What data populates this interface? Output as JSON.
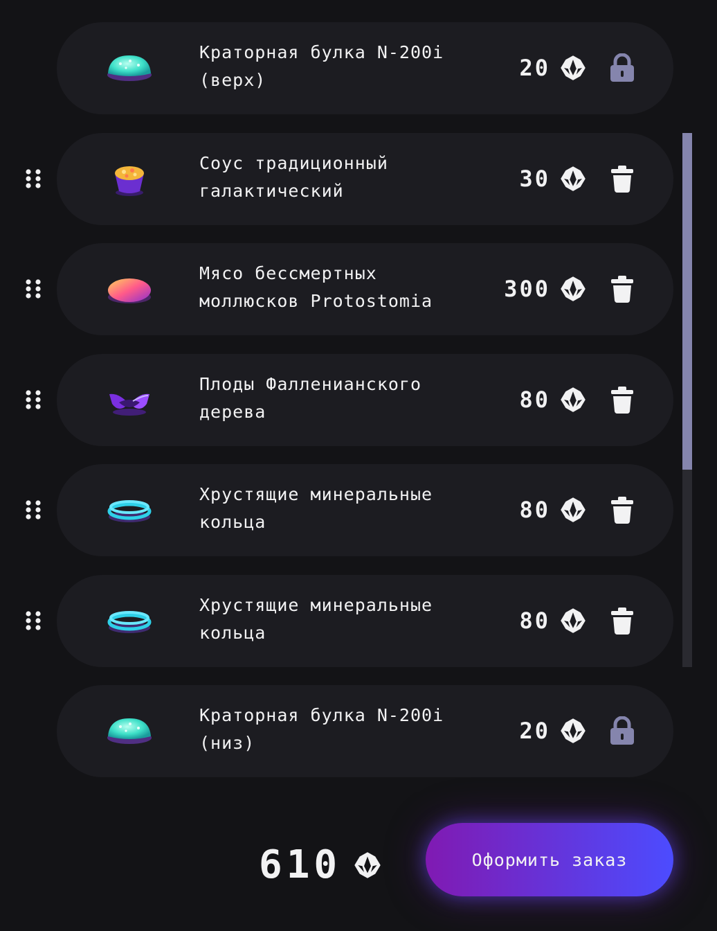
{
  "ingredients": [
    {
      "name": "Краторная булка N-200i\n(верх)",
      "price": "20",
      "locked": true,
      "draggable": false,
      "thumb": "bun-image"
    },
    {
      "name": "Соус традиционный\nгалактический",
      "price": "30",
      "locked": false,
      "draggable": true,
      "thumb": "sauce-image"
    },
    {
      "name": "Мясо бессмертных\nмоллюсков Protostomia",
      "price": "300",
      "locked": false,
      "draggable": true,
      "thumb": "meat-image"
    },
    {
      "name": "Плоды Фалленианского\nдерева",
      "price": "80",
      "locked": false,
      "draggable": true,
      "thumb": "fruit-image"
    },
    {
      "name": "Хрустящие минеральные\nкольца",
      "price": "80",
      "locked": false,
      "draggable": true,
      "thumb": "rings-image"
    },
    {
      "name": "Хрустящие минеральные\nкольца",
      "price": "80",
      "locked": false,
      "draggable": true,
      "thumb": "rings-image"
    },
    {
      "name": "Краторная булка N-200i\n(низ)",
      "price": "20",
      "locked": true,
      "draggable": false,
      "thumb": "bun-image"
    }
  ],
  "icons": {
    "currency": "currency-icon",
    "lock": "lock-icon",
    "delete": "trash-icon",
    "drag": "drag-handle-icon"
  },
  "total": {
    "value": "610"
  },
  "order_button": {
    "label": "Оформить заказ"
  },
  "colors": {
    "background": "#131316",
    "card": "#1c1c21",
    "text": "#f2f2f3",
    "locked_icon": "#8585ad",
    "scrollbar_thumb": "#8585ad",
    "scrollbar_track": "#2a2a30",
    "button_gradient_start": "#801ab2",
    "button_gradient_end": "#4c4cff"
  },
  "scrollbar": {
    "visible_fraction": 0.63
  }
}
